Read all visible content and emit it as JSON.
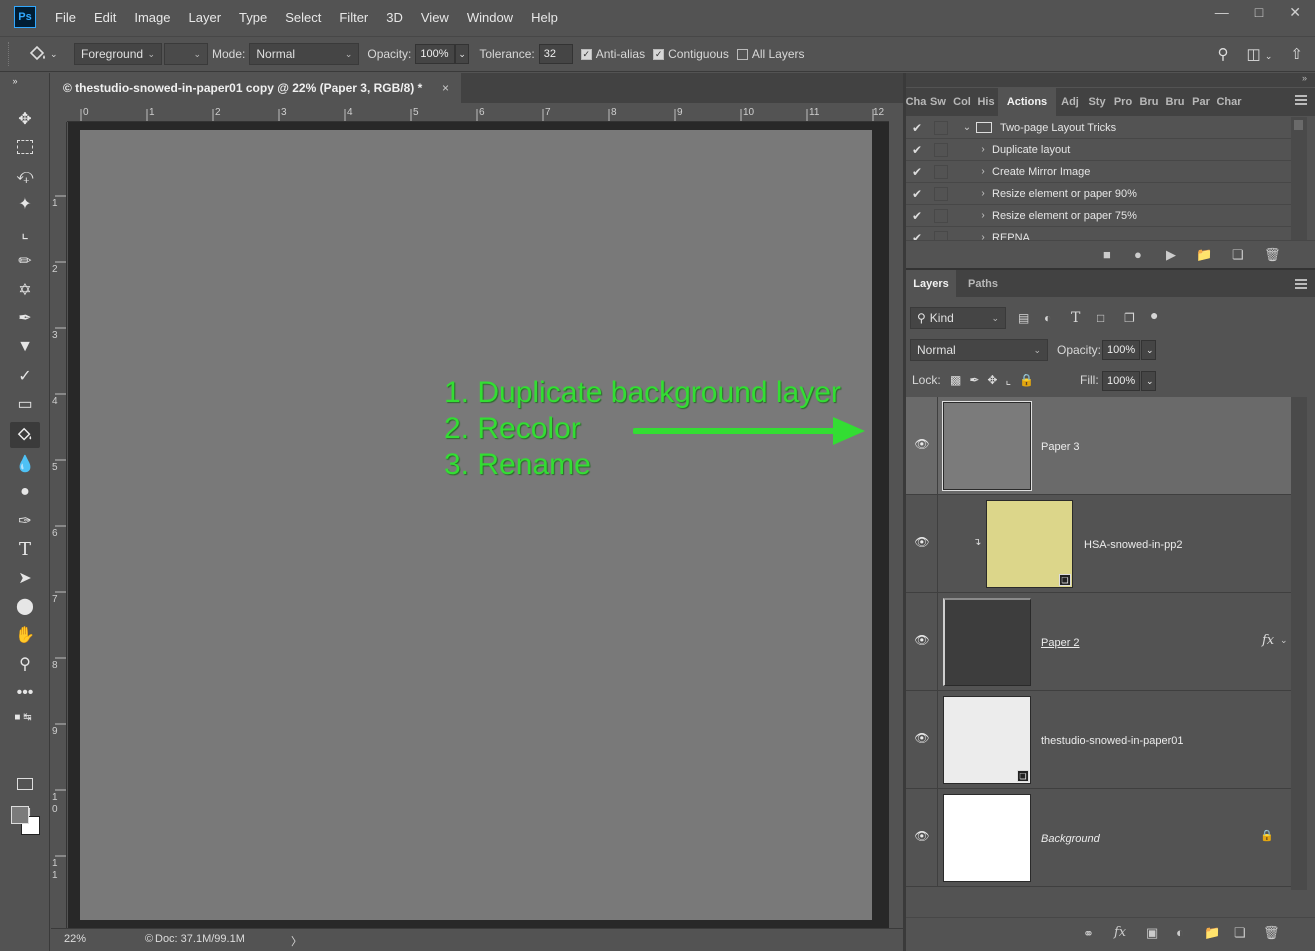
{
  "app": {
    "logo": "Ps",
    "menu": [
      "File",
      "Edit",
      "Image",
      "Layer",
      "Type",
      "Select",
      "Filter",
      "3D",
      "View",
      "Window",
      "Help"
    ],
    "window_controls": [
      "minimize-icon",
      "maximize-icon",
      "close-icon"
    ]
  },
  "options": {
    "fill_source": "Foreground",
    "mode_label": "Mode:",
    "mode_value": "Normal",
    "opacity_label": "Opacity:",
    "opacity_value": "100%",
    "tolerance_label": "Tolerance:",
    "tolerance_value": "32",
    "antialias_label": "Anti-alias",
    "antialias_checked": true,
    "contiguous_label": "Contiguous",
    "contiguous_checked": true,
    "all_layers_label": "All Layers",
    "all_layers_checked": false
  },
  "document": {
    "tab_title": "© thestudio-snowed-in-paper01 copy @ 22% (Paper 3, RGB/8) *",
    "close": "×",
    "ruler_top": [
      "0",
      "1",
      "2",
      "3",
      "4",
      "5",
      "6",
      "7",
      "8",
      "9",
      "10",
      "11",
      "12"
    ],
    "ruler_left": [
      "1",
      "2",
      "3",
      "4",
      "5",
      "6",
      "7",
      "8",
      "9",
      "1\n0",
      "1\n1"
    ],
    "zoom": "22%",
    "doc_info": "Doc: 37.1M/99.1M",
    "status_arrow": "〉",
    "canvas_color": "#797979"
  },
  "annotation": {
    "lines": [
      "1. Duplicate background layer",
      "2. Recolor",
      "3. Rename"
    ],
    "color": "#33dd33"
  },
  "top_panel": {
    "tabs": [
      "Cha",
      "Sw",
      "Col",
      "His",
      "Actions",
      "Adj",
      "Sty",
      "Pro",
      "Bru",
      "Bru",
      "Par",
      "Char"
    ],
    "active_tab": "Actions",
    "actions": [
      {
        "name": "Two-page Layout Tricks",
        "type": "set"
      },
      {
        "name": "Duplicate layout",
        "type": "action"
      },
      {
        "name": "Create Mirror Image",
        "type": "action"
      },
      {
        "name": "Resize element or paper 90%",
        "type": "action"
      },
      {
        "name": "Resize element or paper 75%",
        "type": "action"
      },
      {
        "name": "REPNA",
        "type": "action"
      }
    ]
  },
  "layers_panel": {
    "tabs": [
      "Layers",
      "Paths"
    ],
    "active_tab": "Layers",
    "filter_kind": "Kind",
    "blend_mode": "Normal",
    "opacity_label": "Opacity:",
    "opacity_value": "100%",
    "lock_label": "Lock:",
    "fill_label": "Fill:",
    "fill_value": "100%",
    "layers": [
      {
        "name": "Paper 3",
        "selected": true,
        "thumb_color": "#7b7b7b"
      },
      {
        "name": "HSA-snowed-in-pp2",
        "clipped": true,
        "smart": true,
        "thumb_color": "#dcd68a"
      },
      {
        "name": "Paper 2",
        "fx": "fx",
        "thumb_color": "#3d3d3d"
      },
      {
        "name": "thestudio-snowed-in-paper01",
        "smart": true,
        "thumb_color": "#ececec"
      },
      {
        "name": "Background",
        "locked": true,
        "thumb_color": "#ffffff"
      }
    ]
  }
}
